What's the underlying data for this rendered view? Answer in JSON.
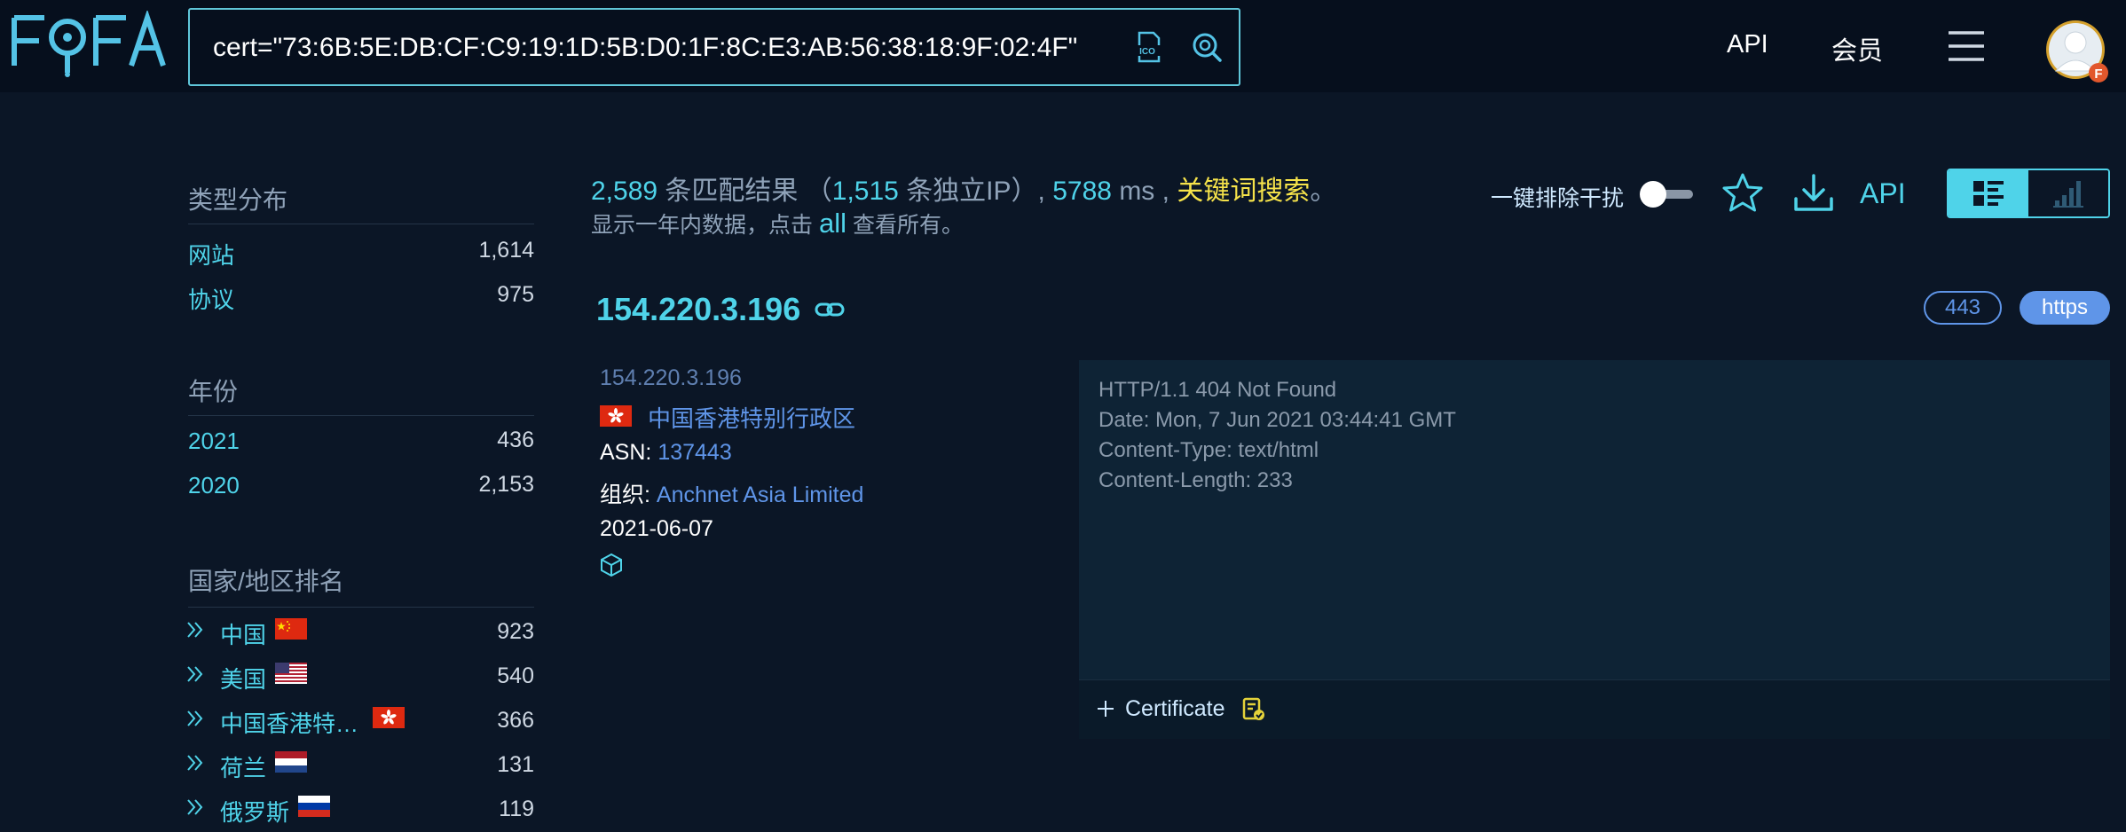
{
  "header": {
    "logo_text": "FOFA",
    "search_query": "cert=\"73:6B:5E:DB:CF:C9:19:1D:5B:D0:1F:8C:E3:AB:56:38:18:9F:02:4F\"",
    "ico_label": "ICO",
    "nav_api": "API",
    "nav_member": "会员",
    "avatar_badge": "F"
  },
  "sidebar": {
    "type_title": "类型分布",
    "types": [
      {
        "label": "网站",
        "count": "1,614"
      },
      {
        "label": "协议",
        "count": "975"
      }
    ],
    "year_title": "年份",
    "years": [
      {
        "label": "2021",
        "count": "436"
      },
      {
        "label": "2020",
        "count": "2,153"
      }
    ],
    "country_title": "国家/地区排名",
    "countries": [
      {
        "label": "中国",
        "count": "923",
        "flag": "cn"
      },
      {
        "label": "美国",
        "count": "540",
        "flag": "us"
      },
      {
        "label": "中国香港特…",
        "count": "366",
        "flag": "hk"
      },
      {
        "label": "荷兰",
        "count": "131",
        "flag": "nl"
      },
      {
        "label": "俄罗斯",
        "count": "119",
        "flag": "ru"
      }
    ]
  },
  "summary": {
    "match_count": "2,589",
    "match_label": "条匹配结果",
    "open_paren": "（",
    "unique_ip_count": "1,515",
    "unique_ip_label": "条独立IP）,",
    "time_value": "5788",
    "time_unit": "ms ,",
    "keyword_link": "关键词搜索",
    "period": "。",
    "note_before": "显示一年内数据，点击",
    "all_link": "all",
    "note_after": "查看所有。"
  },
  "toolbar": {
    "exclude_label": "一键排除干扰",
    "exclude_enabled": false,
    "api_label": "API",
    "view_mode": "list"
  },
  "result": {
    "ip": "154.220.3.196",
    "port": "443",
    "protocol": "https",
    "ip_sub": "154.220.3.196",
    "region": "中国香港特别行政区",
    "asn_label": "ASN:",
    "asn": "137443",
    "org_label": "组织:",
    "org": "Anchnet Asia Limited",
    "date": "2021-06-07",
    "response_lines": [
      "HTTP/1.1 404 Not Found",
      "Date: Mon, 7 Jun 2021 03:44:41 GMT",
      "Content-Type: text/html",
      "Content-Length: 233"
    ],
    "certificate_label": "Certificate"
  },
  "colors": {
    "accent": "#4fd3e9",
    "link_blue": "#5f95e8",
    "keyword_yellow": "#f6e34a",
    "background": "#0b1626"
  }
}
